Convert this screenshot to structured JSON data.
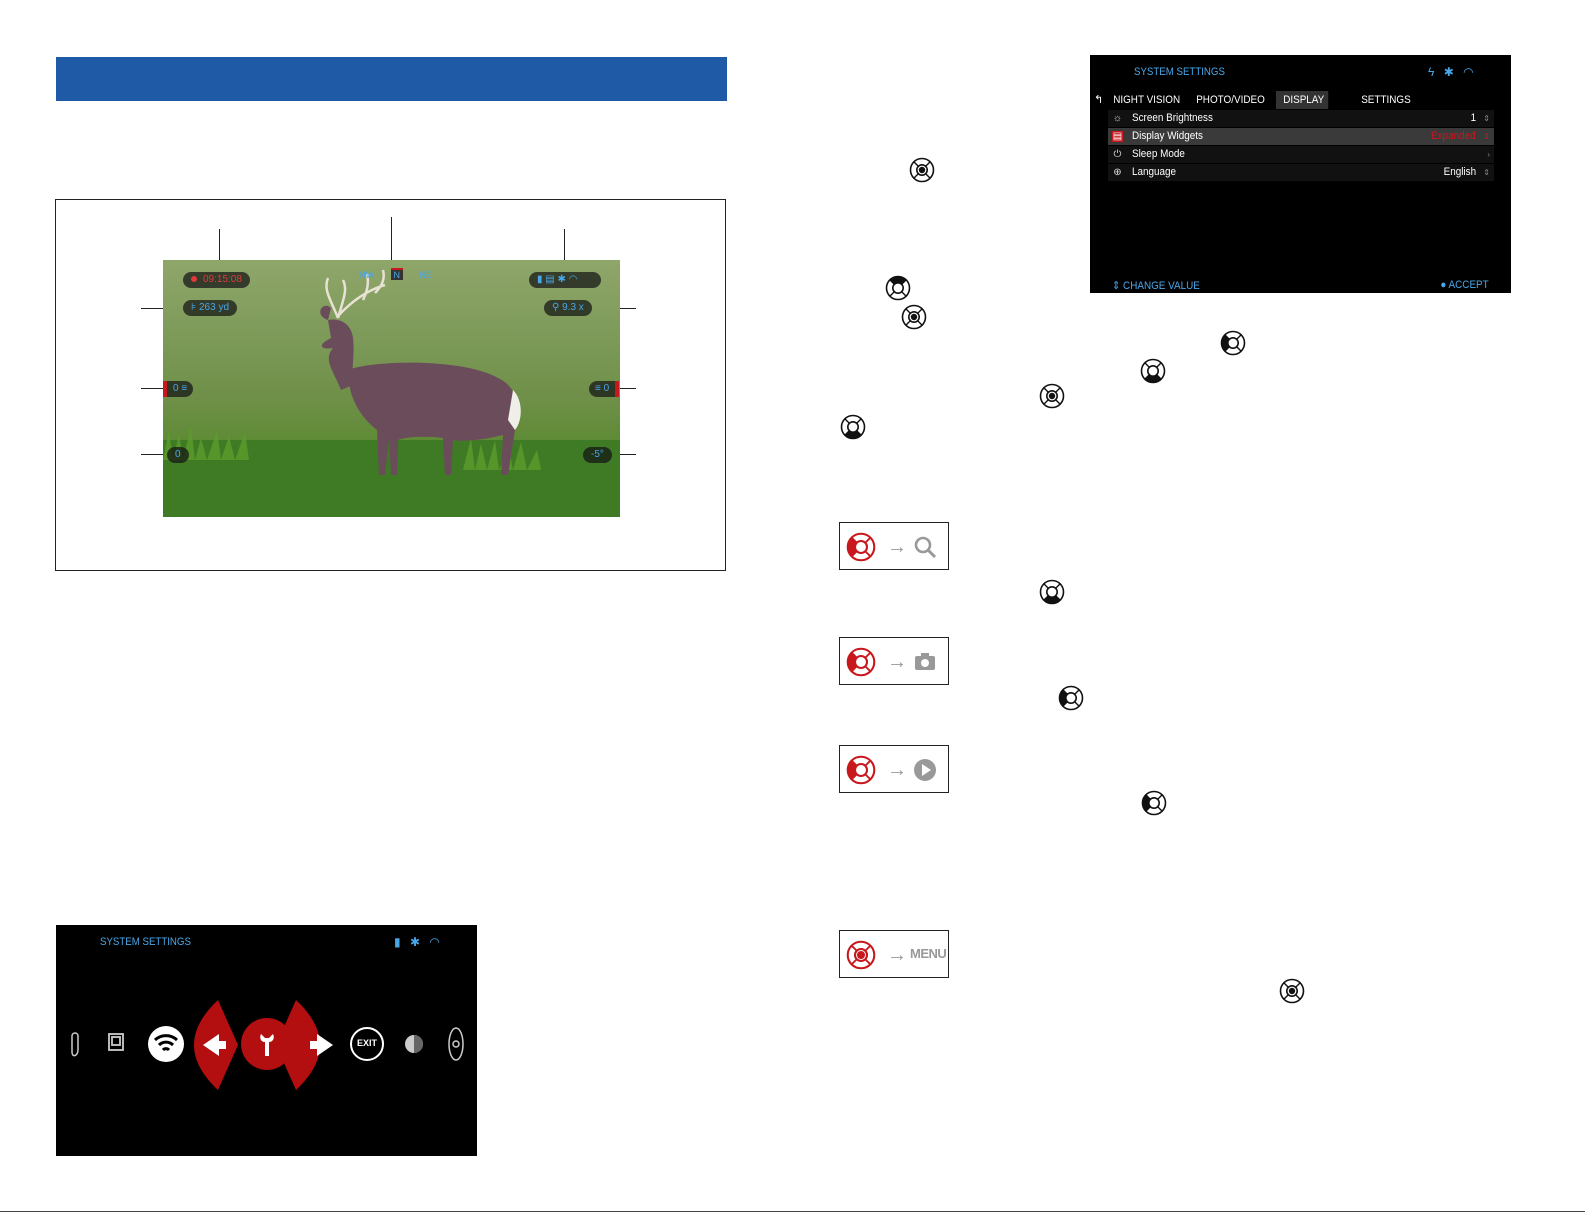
{
  "settings_screen": {
    "title": "SYSTEM SETTINGS",
    "tabs": [
      "NIGHT VISION",
      "PHOTO/VIDEO",
      "DISPLAY",
      "SETTINGS"
    ],
    "active_tab": "DISPLAY",
    "rows": [
      {
        "label": "Screen Brightness",
        "value": "1",
        "icon": "brightness-icon"
      },
      {
        "label": "Display Widgets",
        "value": "Expanded",
        "icon": "widgets-icon"
      },
      {
        "label": "Sleep Mode",
        "value": "",
        "icon": "power-icon"
      },
      {
        "label": "Language",
        "value": "English",
        "icon": "globe-icon"
      }
    ],
    "change_value": "CHANGE VALUE",
    "accept": "ACCEPT"
  },
  "overlay": {
    "rec_time": "09:15:08",
    "range": "263 yd",
    "zoom": "9.3 x",
    "compass_left": "NW",
    "compass_center": "N",
    "compass_right": "NE",
    "left_level": "0",
    "right_level": "0",
    "bottom_left": "0",
    "bottom_right": "-5°"
  },
  "menu_screen": {
    "title": "SYSTEM SETTINGS",
    "exit_label": "EXIT"
  },
  "hint_boxes": {
    "menu_label": "MENU"
  },
  "colors": {
    "header_blue": "#1f5aa6",
    "ui_blue": "#49a6e8",
    "accent_red": "#c8181d"
  }
}
